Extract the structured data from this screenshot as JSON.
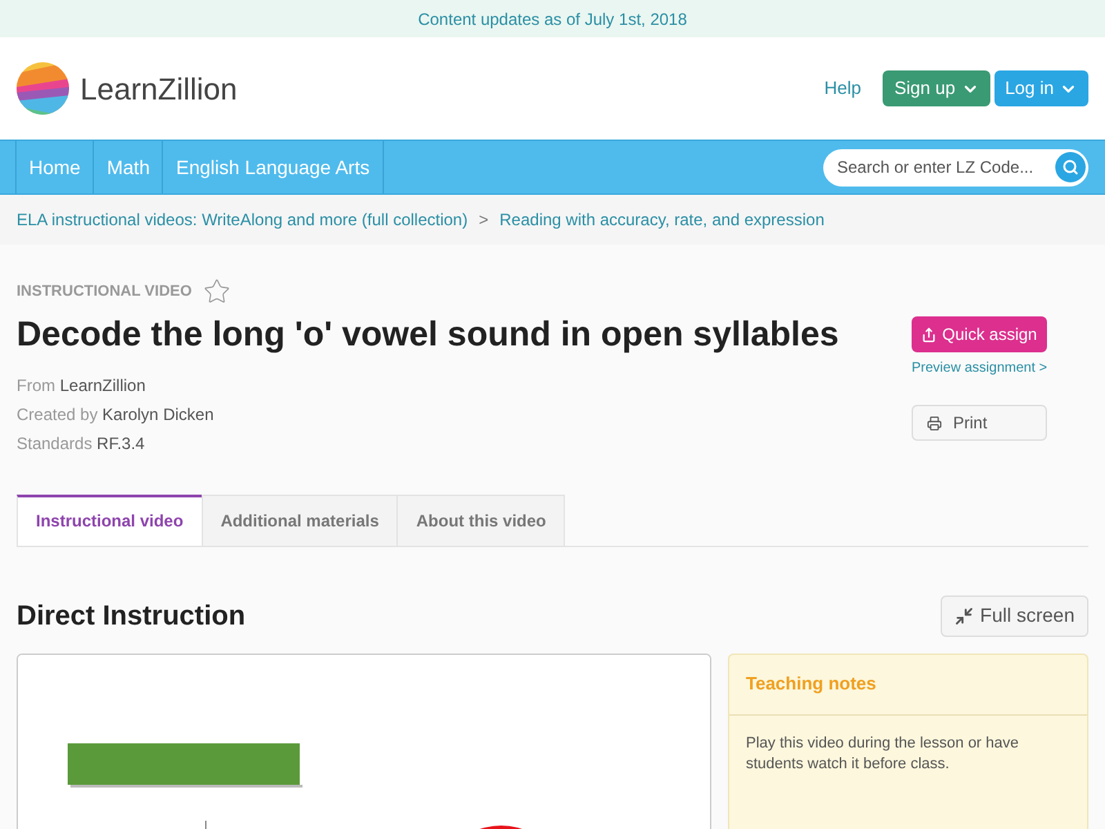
{
  "banner": "Content updates as of July 1st, 2018",
  "header": {
    "logo_text": "LearnZillion",
    "help": "Help",
    "signup": "Sign up",
    "login": "Log in"
  },
  "nav": {
    "items": [
      {
        "label": "Home"
      },
      {
        "label": "Math"
      },
      {
        "label": "English Language Arts"
      }
    ],
    "search": {
      "placeholder": "Search or enter LZ Code..."
    }
  },
  "breadcrumb": [
    {
      "label": "ELA instructional videos: WriteAlong and more (full collection)"
    },
    {
      "label": "Reading with accuracy, rate, and expression"
    }
  ],
  "breadcrumb_separator": ">",
  "lesson": {
    "kind_label": "INSTRUCTIONAL VIDEO",
    "favorited": false,
    "title": "Decode the long 'o' vowel sound in open syllables",
    "meta": [
      {
        "label": "From",
        "value": "LearnZillion"
      },
      {
        "label": "Created by",
        "value": "Karolyn Dicken"
      },
      {
        "label": "Standards",
        "value": "RF.3.4"
      }
    ],
    "quick_assign": "Quick assign",
    "preview": "Preview assignment >",
    "print": "Print"
  },
  "tabs": [
    {
      "label": "Instructional video",
      "selected": true
    },
    {
      "label": "Additional materials",
      "selected": false
    },
    {
      "label": "About this video",
      "selected": false
    }
  ],
  "section": {
    "title": "Direct Instruction",
    "full_screen": "Full screen",
    "notes": {
      "title": "Teaching notes",
      "text": "Play this video during the lesson or have students watch it before class."
    }
  }
}
